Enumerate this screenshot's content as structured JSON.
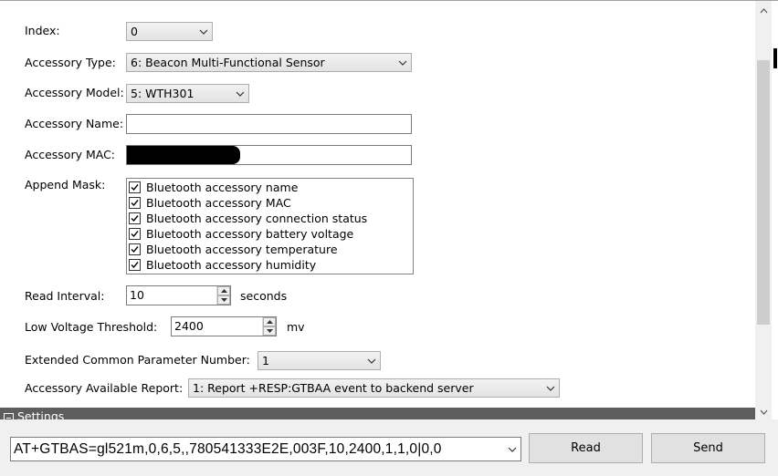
{
  "form": {
    "index_label": "Index:",
    "index_value": "0",
    "type_label": "Accessory Type:",
    "type_value": "6: Beacon Multi-Functional Sensor",
    "model_label": "Accessory Model:",
    "model_value": "5: WTH301",
    "name_label": "Accessory Name:",
    "name_value": "",
    "mac_label": "Accessory MAC:",
    "mask_label": "Append Mask:",
    "mask_items": [
      {
        "label": "Bluetooth accessory name",
        "checked": true
      },
      {
        "label": "Bluetooth accessory MAC",
        "checked": true
      },
      {
        "label": "Bluetooth accessory connection status",
        "checked": true
      },
      {
        "label": "Bluetooth accessory battery voltage",
        "checked": true
      },
      {
        "label": "Bluetooth accessory temperature",
        "checked": true
      },
      {
        "label": "Bluetooth accessory humidity",
        "checked": true
      }
    ],
    "interval_label": "Read Interval:",
    "interval_value": "10",
    "interval_unit": "seconds",
    "voltage_label": "Low Voltage Threshold:",
    "voltage_value": "2400",
    "voltage_unit": "mv",
    "ext_label": "Extended Common Parameter Number:",
    "ext_value": "1",
    "report_label": "Accessory Available Report:",
    "report_value": "1: Report +RESP:GTBAA event to backend server"
  },
  "settings_section": {
    "title": "Settings"
  },
  "command": {
    "value": "AT+GTBAS=gl521m,0,6,5,,780541333E2E,003F,10,2400,1,1,0|0,0",
    "read_label": "Read",
    "send_label": "Send"
  },
  "icons": {
    "dropdown": "chevron-down-icon",
    "check": "checkmark-icon",
    "spin_up": "spin-up-icon",
    "spin_down": "spin-down-icon",
    "scroll_up": "scroll-up-arrow-icon",
    "scroll_down": "scroll-down-arrow-icon",
    "collapse": "collapse-box-icon"
  }
}
